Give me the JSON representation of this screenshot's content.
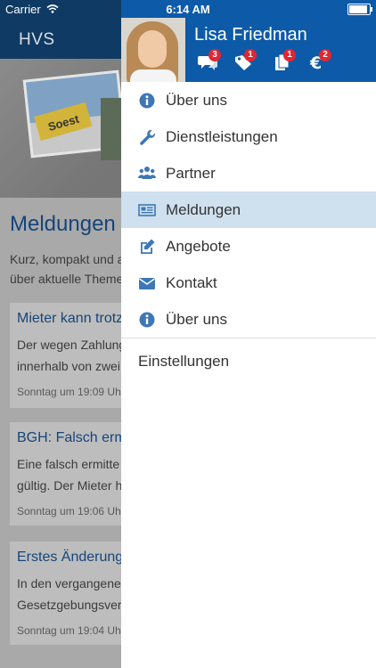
{
  "status_bar": {
    "carrier": "Carrier",
    "time": "6:14 AM"
  },
  "background": {
    "app_title": "HVS",
    "sign_text": "Soest",
    "heading": "Meldungen",
    "intro": [
      "Kurz, kompakt und a",
      "über aktuelle Theme"
    ],
    "cards": [
      {
        "title": "Mieter kann trotz",
        "lines": [
          "Der wegen Zahlung",
          "innerhalb von zwei"
        ],
        "date": "Sonntag um 19:09 Uh"
      },
      {
        "title": "BGH: Falsch erm",
        "lines": [
          "Eine falsch ermitte",
          "gültig. Der Mieter h"
        ],
        "date": "Sonntag um 19:06 Uh"
      },
      {
        "title": "Erstes Änderung",
        "lines": [
          "In den vergangene",
          "Gesetzgebungsver"
        ],
        "date": "Sonntag um 19:04 Uh"
      }
    ]
  },
  "drawer": {
    "user_name": "Lisa Friedman",
    "header_icons": [
      {
        "icon": "chat-icon",
        "badge": "3"
      },
      {
        "icon": "tag-icon",
        "badge": "1"
      },
      {
        "icon": "documents-icon",
        "badge": "1"
      },
      {
        "icon": "euro-icon",
        "badge": "2"
      }
    ],
    "menu": [
      {
        "icon": "info-icon",
        "label": "Über uns"
      },
      {
        "icon": "wrench-icon",
        "label": "Dienstleistungen"
      },
      {
        "icon": "users-icon",
        "label": "Partner"
      },
      {
        "icon": "newspaper-icon",
        "label": "Meldungen",
        "active": true
      },
      {
        "icon": "edit-icon",
        "label": "Angebote"
      },
      {
        "icon": "envelope-icon",
        "label": "Kontakt"
      },
      {
        "icon": "info-icon",
        "label": "Über uns"
      }
    ],
    "settings_label": "Einstellungen"
  },
  "colors": {
    "accent": "#0d5aa8",
    "icon": "#3e77b5",
    "active_row": "#cfe0ef",
    "badge": "#e3262f"
  }
}
